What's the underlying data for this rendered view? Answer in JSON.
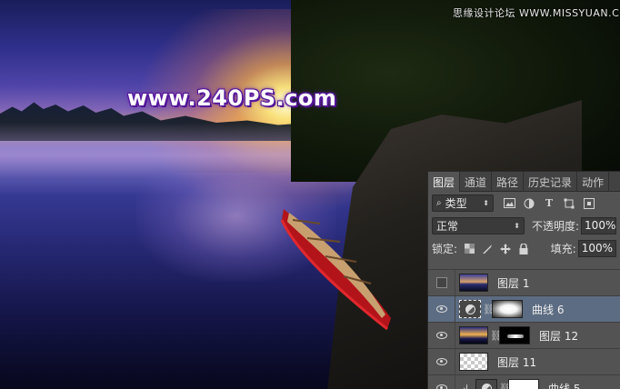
{
  "watermark": {
    "top_right": "思缘设计论坛 WWW.MISSYUAN.COM"
  },
  "logo": {
    "text": "www.240PS.com"
  },
  "panel": {
    "tabs": [
      {
        "label": "图层",
        "active": true
      },
      {
        "label": "通道",
        "active": false
      },
      {
        "label": "路径",
        "active": false
      },
      {
        "label": "历史记录",
        "active": false
      },
      {
        "label": "动作",
        "active": false
      }
    ],
    "filter": {
      "kind_label": "类型",
      "icons": [
        "image-filter-icon",
        "adjustment-filter-icon",
        "type-filter-icon",
        "shape-filter-icon",
        "smart-object-filter-icon"
      ]
    },
    "blend_mode": "正常",
    "opacity_label": "不透明度:",
    "opacity_value": "100%",
    "lock_label": "锁定:",
    "fill_label": "填充:",
    "fill_value": "100%",
    "layers": [
      {
        "name": "图层 1",
        "visible": false,
        "selected": false,
        "thumb": "photo",
        "mask": null
      },
      {
        "name": "曲线 6",
        "visible": true,
        "selected": true,
        "thumb": "adjustment",
        "mask": "white-blob"
      },
      {
        "name": "图层 12",
        "visible": true,
        "selected": false,
        "thumb": "photo2",
        "mask": "black-line"
      },
      {
        "name": "图层 11",
        "visible": true,
        "selected": false,
        "thumb": "transparent",
        "mask": null
      },
      {
        "name": "曲线 5",
        "visible": true,
        "selected": false,
        "thumb": "adjustment",
        "mask": "white",
        "clipped": true
      }
    ]
  }
}
